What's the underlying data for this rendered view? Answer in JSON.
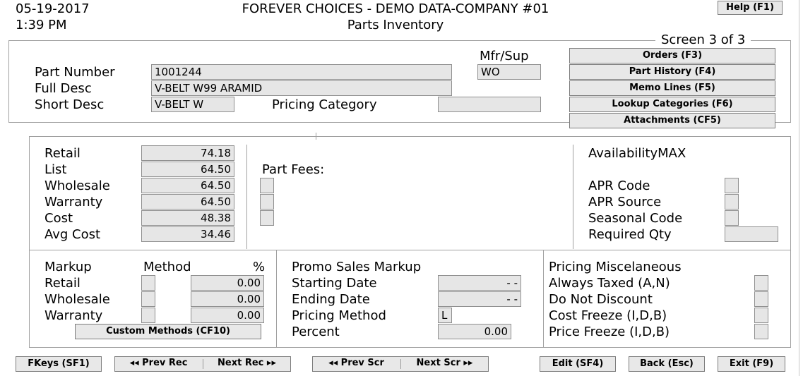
{
  "header": {
    "date": "05-19-2017",
    "time": "1:39 PM",
    "company": "FOREVER CHOICES - DEMO DATA-COMPANY #01",
    "screen_name": "Parts Inventory",
    "help_button": "Help (F1)",
    "screen_indicator": "Screen 3 of 3"
  },
  "part": {
    "part_number_label": "Part Number",
    "part_number": "1001244",
    "full_desc_label": "Full Desc",
    "full_desc": "V-BELT W99 ARAMID",
    "short_desc_label": "Short Desc",
    "short_desc": "V-BELT W",
    "pricing_category_label": "Pricing Category",
    "pricing_category": "",
    "mfr_sup_label": "Mfr/Sup",
    "mfr_sup": "WO"
  },
  "side_buttons": {
    "orders": "Orders (F3)",
    "part_history": "Part History (F4)",
    "memo_lines": "Memo Lines (F5)",
    "lookup_categories": "Lookup Categories (F6)",
    "attachments": "Attachments (CF5)"
  },
  "prices": {
    "retail_label": "Retail",
    "retail": "74.18",
    "list_label": "List",
    "list": "64.50",
    "wholesale_label": "Wholesale",
    "wholesale": "64.50",
    "warranty_label": "Warranty",
    "warranty": "64.50",
    "cost_label": "Cost",
    "cost": "48.38",
    "avg_cost_label": "Avg Cost",
    "avg_cost": "34.46"
  },
  "fees": {
    "label": "Part Fees:",
    "fee1": "",
    "fee2": "",
    "fee3": ""
  },
  "availability": {
    "title": "AvailabilityMAX",
    "apr_code_label": "APR Code",
    "apr_code": "",
    "apr_source_label": "APR Source",
    "apr_source": "",
    "seasonal_code_label": "Seasonal Code",
    "seasonal_code": "",
    "required_qty_label": "Required Qty",
    "required_qty": ""
  },
  "markup": {
    "title": "Markup",
    "method_header": "Method",
    "percent_header": "%",
    "retail_label": "Retail",
    "retail_method": "",
    "retail_pct": "0.00",
    "wholesale_label": "Wholesale",
    "wholesale_method": "",
    "wholesale_pct": "0.00",
    "warranty_label": "Warranty",
    "warranty_method": "",
    "warranty_pct": "0.00",
    "custom_methods_button": "Custom Methods (CF10)"
  },
  "promo": {
    "title": "Promo Sales Markup",
    "starting_date_label": "Starting Date",
    "starting_date": "- -",
    "ending_date_label": "Ending Date",
    "ending_date": "- -",
    "pricing_method_label": "Pricing Method",
    "pricing_method": "L",
    "percent_label": "Percent",
    "percent": "0.00"
  },
  "misc": {
    "title": "Pricing Miscelaneous",
    "always_taxed_label": "Always Taxed (A,N)",
    "always_taxed": "",
    "do_not_discount_label": "Do Not Discount",
    "do_not_discount": "",
    "cost_freeze_label": "Cost Freeze (I,D,B)",
    "cost_freeze": "",
    "price_freeze_label": "Price Freeze (I,D,B)",
    "price_freeze": ""
  },
  "footer": {
    "fkeys": "FKeys (SF1)",
    "prev_rec": "◂◂ Prev Rec",
    "next_rec": "Next Rec ▸▸",
    "prev_scr": "◂◂ Prev Scr",
    "next_scr": "Next Scr ▸▸",
    "edit": "Edit (SF4)",
    "back": "Back (Esc)",
    "exit": "Exit (F9)"
  }
}
